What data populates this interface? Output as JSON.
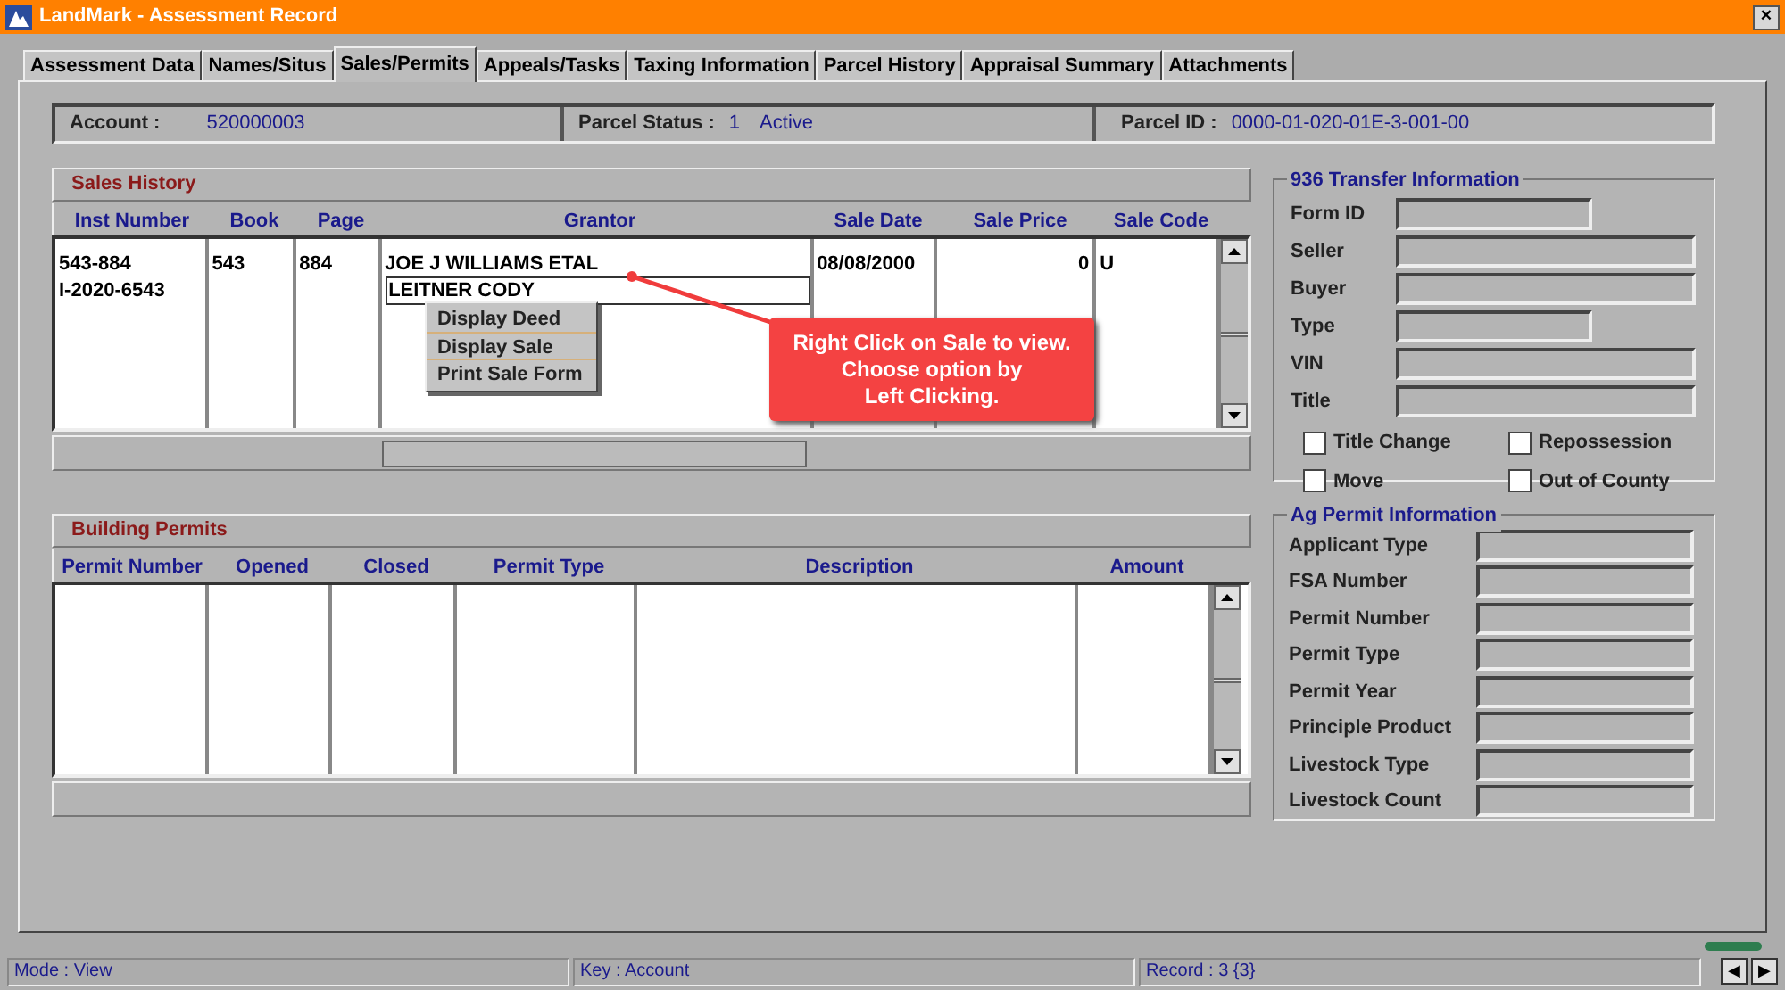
{
  "window": {
    "title": "LandMark - Assessment Record",
    "close": "×"
  },
  "tabs": [
    {
      "label": "Assessment Data",
      "selected": false
    },
    {
      "label": "Names/Situs",
      "selected": false
    },
    {
      "label": "Sales/Permits",
      "selected": true
    },
    {
      "label": "Appeals/Tasks",
      "selected": false
    },
    {
      "label": "Taxing Information",
      "selected": false
    },
    {
      "label": "Parcel History",
      "selected": false
    },
    {
      "label": "Appraisal Summary",
      "selected": false
    },
    {
      "label": "Attachments",
      "selected": false
    }
  ],
  "header": {
    "account_label": "Account :",
    "account": "520000003",
    "status_label": "Parcel Status :",
    "status_code": "1",
    "status": "Active",
    "parcel_label": "Parcel ID :",
    "parcel_id": "0000-01-020-01E-3-001-00"
  },
  "sales_history": {
    "title": "Sales History",
    "columns": [
      "Inst Number",
      "Book",
      "Page",
      "Grantor",
      "Sale Date",
      "Sale Price",
      "Sale Code"
    ],
    "rows": [
      {
        "cells": [
          "543-884",
          "543",
          "884",
          "JOE J WILLIAMS ETAL",
          "08/08/2000",
          "0",
          "U"
        ],
        "selected": false
      },
      {
        "cells": [
          "I-2020-6543",
          "",
          "",
          "LEITNER CODY",
          "",
          "",
          ""
        ],
        "selected": true
      }
    ]
  },
  "context_menu": [
    "Display Deed",
    "Display Sale",
    "Print Sale Form"
  ],
  "callout": {
    "lines": [
      "Right Click on Sale to view.",
      "Choose option by",
      "Left Clicking."
    ]
  },
  "building_permits": {
    "title": "Building Permits",
    "columns": [
      "Permit Number",
      "Opened",
      "Closed",
      "Permit Type",
      "Description",
      "Amount"
    ]
  },
  "transfer": {
    "title": "936 Transfer Information",
    "fields": [
      {
        "label": "Form ID",
        "short": true
      },
      {
        "label": "Seller",
        "short": false
      },
      {
        "label": "Buyer",
        "short": false
      },
      {
        "label": "Type",
        "short": true
      },
      {
        "label": "VIN",
        "short": false
      },
      {
        "label": "Title",
        "short": false
      }
    ],
    "checkboxes": [
      {
        "label": "Title Change",
        "checked": false
      },
      {
        "label": "Repossession",
        "checked": false
      },
      {
        "label": "Move",
        "checked": false
      },
      {
        "label": "Out of County",
        "checked": false
      }
    ]
  },
  "ag_permit": {
    "title": "Ag Permit Information",
    "fields": [
      "Applicant Type",
      "FSA Number",
      "Permit Number",
      "Permit Type",
      "Permit Year",
      "Principle Product",
      "Livestock Type",
      "Livestock Count"
    ]
  },
  "status_bar": [
    "Mode : View",
    "Key : Account",
    "Record : 3 {3}"
  ],
  "nav": [
    "◀",
    "▶"
  ]
}
